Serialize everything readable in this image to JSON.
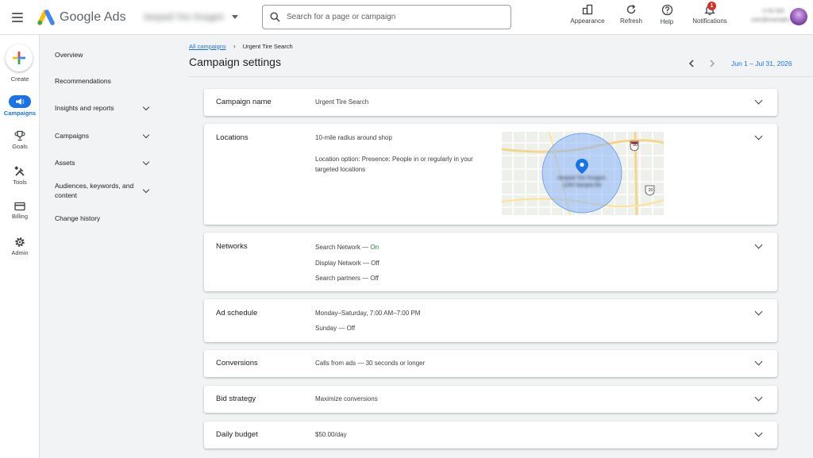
{
  "header": {
    "brand": "Google Ads",
    "account_name": "Aerpedi Tire Snogert",
    "search_placeholder": "Search for a page or campaign",
    "tools": [
      {
        "label": "Appearance",
        "icon": "appearance-icon"
      },
      {
        "label": "Refresh",
        "icon": "refresh-icon"
      },
      {
        "label": "Help",
        "icon": "help-icon"
      },
      {
        "label": "Notifications",
        "icon": "bell-icon"
      }
    ],
    "notification_count": "1",
    "user_id": "0 00 000",
    "user_email": "user@example.com"
  },
  "rail": {
    "create": "Create",
    "items": [
      {
        "label": "Campaigns",
        "icon": "megaphone-icon",
        "active": true
      },
      {
        "label": "Goals",
        "icon": "trophy-icon"
      },
      {
        "label": "Tools",
        "icon": "tools-icon"
      },
      {
        "label": "Billing",
        "icon": "credit-card-icon"
      },
      {
        "label": "Admin",
        "icon": "gear-icon"
      }
    ]
  },
  "nav": {
    "items": [
      {
        "label": "Overview"
      },
      {
        "label": "Recommendations"
      },
      {
        "label": "Insights and reports",
        "expandable": true
      },
      {
        "label": "Campaigns",
        "expandable": true
      },
      {
        "label": "Assets",
        "expandable": true
      },
      {
        "label": "Audiences, keywords, and content",
        "expandable": true
      },
      {
        "label": "Change history"
      }
    ]
  },
  "main": {
    "breadcrumb": {
      "link": "All campaigns",
      "current": "Urgent Tire Search"
    },
    "title": "Campaign settings",
    "date_range": "Jun 1 – Jul 31, 2026",
    "cards": {
      "campaign_name": {
        "title": "Campaign name",
        "value": "Urgent Tire Search"
      },
      "locations": {
        "title": "Locations",
        "radius": "10-mile radius around shop",
        "option": "Location option: Presence: People in or regularly in your targeted locations",
        "map_label": "Aerpedi Tire Snogert, 1200 Sample Rd",
        "route_shields": [
          "90",
          "20"
        ]
      },
      "networks": {
        "title": "Networks",
        "search": {
          "name": "Search Network",
          "sep": " — ",
          "status": "On"
        },
        "display": "Display Network — Off",
        "partners": "Search partners — Off"
      },
      "ad_schedule": {
        "title": "Ad schedule",
        "line1": "Monday–Saturday, 7:00 AM–7:00 PM",
        "line2": "Sunday — Off"
      },
      "conversions": {
        "title": "Conversions",
        "value": "Calls from ads — 30 seconds or longer"
      },
      "bid_strategy": {
        "title": "Bid strategy",
        "value": "Maximize conversions"
      },
      "daily_budget": {
        "title": "Daily budget",
        "value": "$50.00/day"
      }
    }
  },
  "colors": {
    "accent": "#1a73e8",
    "on_status": "#188038",
    "badge": "#d93025"
  }
}
